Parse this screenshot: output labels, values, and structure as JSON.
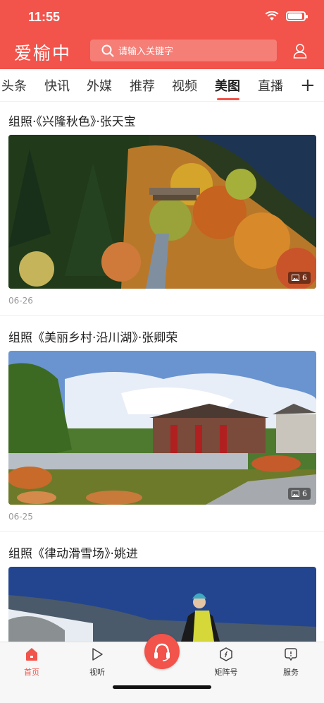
{
  "status_bar": {
    "time": "11:55"
  },
  "header": {
    "logo": "爱榆中",
    "search_placeholder": "请输入关键字"
  },
  "tabs": [
    {
      "label": "头条"
    },
    {
      "label": "快讯"
    },
    {
      "label": "外媒"
    },
    {
      "label": "推荐"
    },
    {
      "label": "视频"
    },
    {
      "label": "美图",
      "active": true
    },
    {
      "label": "直播"
    }
  ],
  "add_tab_label": "+",
  "articles": [
    {
      "title": "组照·《兴隆秋色》·张天宝",
      "image_count": "6",
      "date": "06-26"
    },
    {
      "title": "组照《美丽乡村·沿川湖》·张卿荣",
      "image_count": "6",
      "date": "06-25"
    },
    {
      "title": "组照《律动滑雪场》·姚进"
    }
  ],
  "bottom_nav": [
    {
      "label": "首页",
      "icon": "home-icon",
      "active": true
    },
    {
      "label": "视听",
      "icon": "play-icon"
    },
    {
      "label": "",
      "icon": "headset-icon"
    },
    {
      "label": "矩阵号",
      "icon": "compass-icon"
    },
    {
      "label": "服务",
      "icon": "service-icon"
    }
  ],
  "colors": {
    "accent": "#f2534a"
  }
}
